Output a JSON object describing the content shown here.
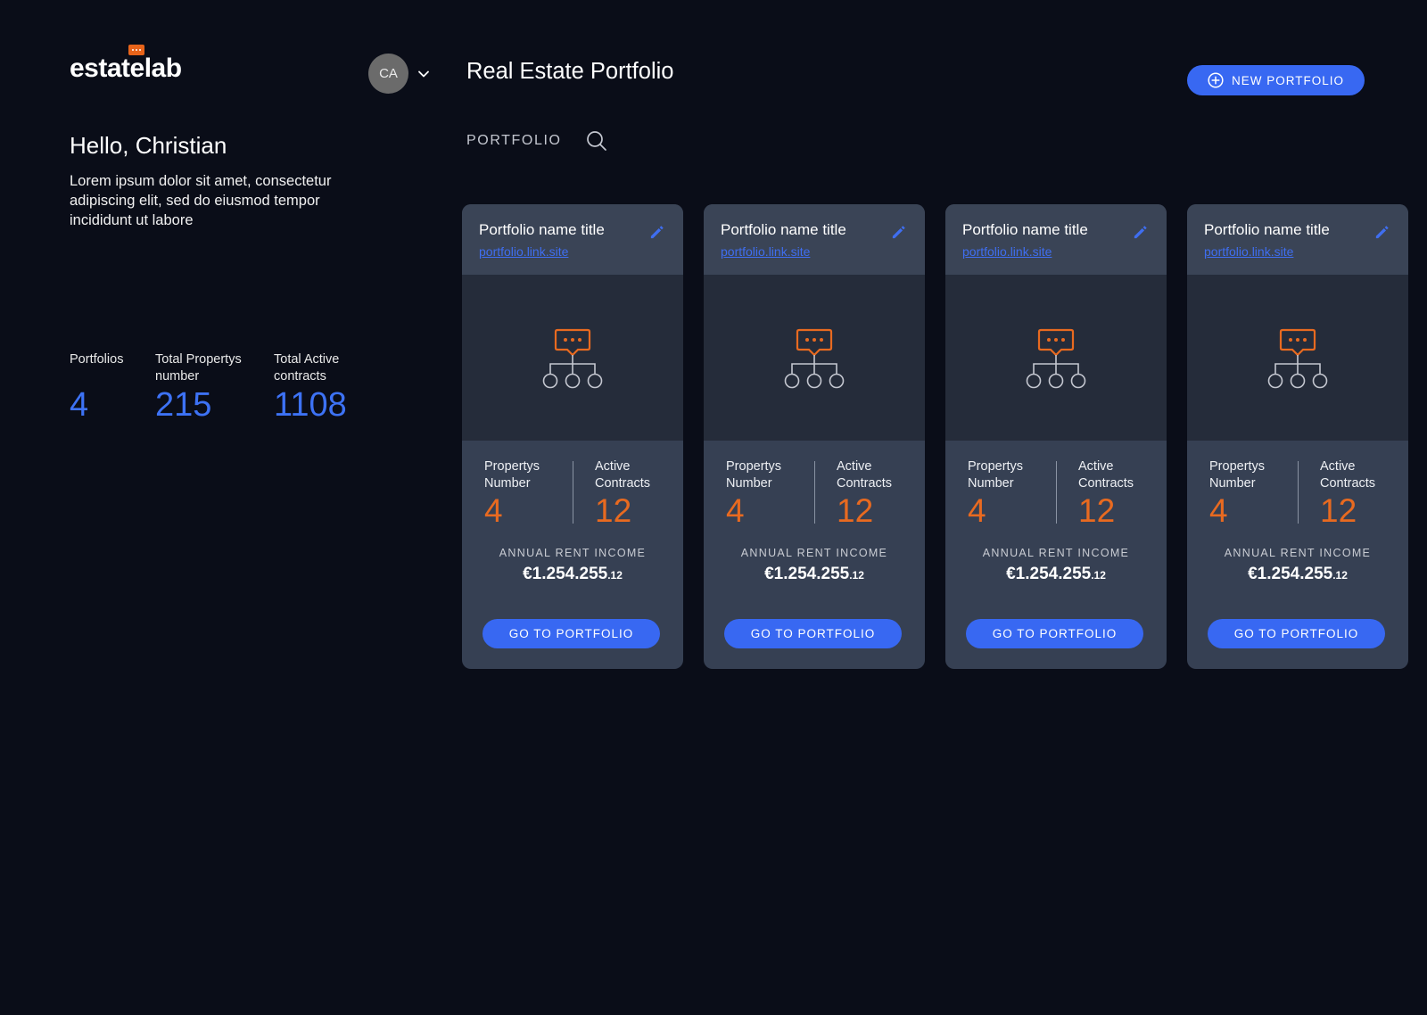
{
  "app": {
    "logo_text": "estatelab",
    "user_initials": "CA"
  },
  "sidebar": {
    "greeting": "Hello, Christian",
    "intro": "Lorem ipsum dolor sit amet, consectetur adipiscing elit, sed do eiusmod tempor incididunt ut labore",
    "stats": [
      {
        "label": "Portfolios",
        "value": "4"
      },
      {
        "label": "Total Propertys number",
        "value": "215"
      },
      {
        "label": "Total Active contracts",
        "value": "1108"
      }
    ]
  },
  "header": {
    "title": "Real Estate Portfolio",
    "new_button": "NEW PORTFOLIO",
    "search_label": "PORTFOLIO"
  },
  "cards": [
    {
      "title": "Portfolio name title",
      "link": "portfolio.link.site",
      "props_label": "Propertys Number",
      "props_value": "4",
      "contracts_label": "Active Contracts",
      "contracts_value": "12",
      "income_label": "ANNUAL RENT INCOME",
      "income_main": "€1.254.255",
      "income_cents": ".12",
      "button": "GO TO PORTFOLIO"
    },
    {
      "title": "Portfolio name title",
      "link": "portfolio.link.site",
      "props_label": "Propertys Number",
      "props_value": "4",
      "contracts_label": "Active Contracts",
      "contracts_value": "12",
      "income_label": "ANNUAL RENT INCOME",
      "income_main": "€1.254.255",
      "income_cents": ".12",
      "button": "GO TO PORTFOLIO"
    },
    {
      "title": "Portfolio name title",
      "link": "portfolio.link.site",
      "props_label": "Propertys Number",
      "props_value": "4",
      "contracts_label": "Active Contracts",
      "contracts_value": "12",
      "income_label": "ANNUAL RENT INCOME",
      "income_main": "€1.254.255",
      "income_cents": ".12",
      "button": "GO TO PORTFOLIO"
    },
    {
      "title": "Portfolio name title",
      "link": "portfolio.link.site",
      "props_label": "Propertys Number",
      "props_value": "4",
      "contracts_label": "Active Contracts",
      "contracts_value": "12",
      "income_label": "ANNUAL RENT INCOME",
      "income_main": "€1.254.255",
      "income_cents": ".12",
      "button": "GO TO PORTFOLIO"
    }
  ],
  "icons": {
    "logo_badge": "chat-bubble-icon",
    "avatar_menu": "chevron-down-icon",
    "new_button": "plus-circle-icon",
    "search": "search-icon",
    "edit": "pencil-icon",
    "card_illustration": "org-chart-chat-icon"
  },
  "colors": {
    "background": "#0a0d18",
    "accent_blue": "#3868f2",
    "accent_orange": "#e86a20",
    "card": "#364053",
    "card_body": "#252c3a"
  }
}
